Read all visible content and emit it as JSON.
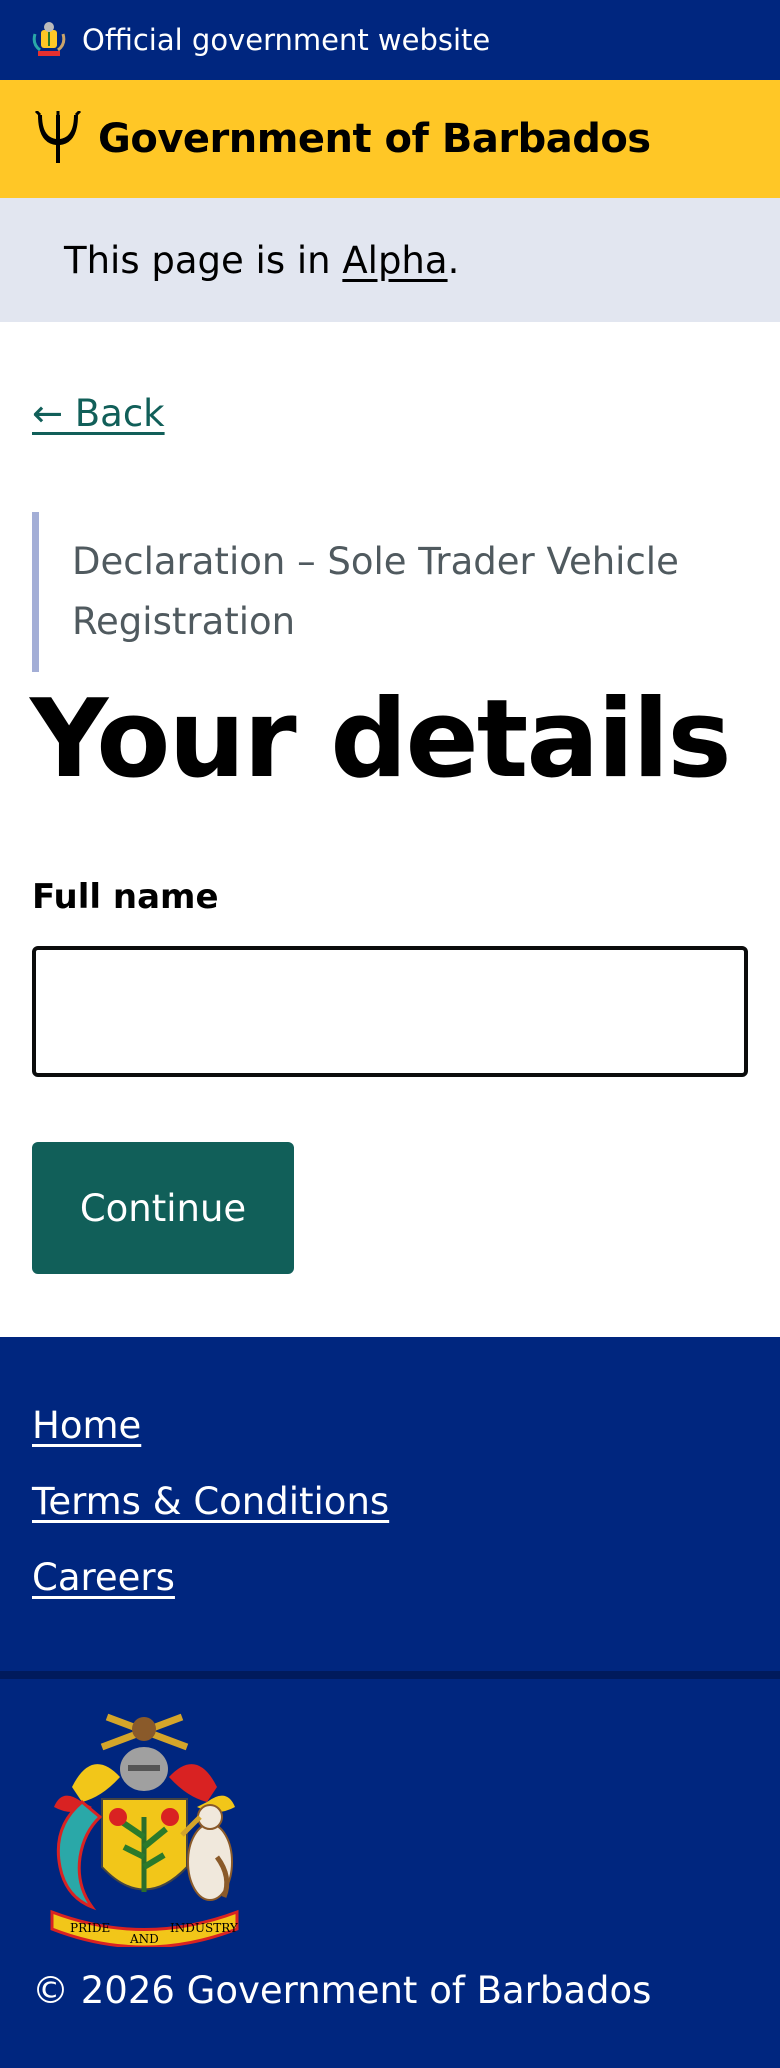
{
  "official_banner": {
    "text": "Official government website"
  },
  "header": {
    "brand": "Government of Barbados"
  },
  "phase_banner": {
    "prefix": "This page is in ",
    "link": "Alpha",
    "suffix": "."
  },
  "nav": {
    "back": "← Back"
  },
  "form": {
    "caption": "Declaration – Sole Trader Vehicle Registration",
    "title": "Your details",
    "full_name_label": "Full name",
    "full_name_value": "",
    "continue_label": "Continue"
  },
  "footer": {
    "links": [
      "Home",
      "Terms & Conditions",
      "Careers"
    ],
    "copyright": "© 2026 Government of Barbados",
    "coat_motto_left": "PRIDE",
    "coat_motto_mid": "AND",
    "coat_motto_right": "INDUSTRY"
  },
  "colors": {
    "navy": "#00267f",
    "yellow": "#ffc726",
    "teal": "#115f59",
    "phase_bg": "#e2e6f0"
  }
}
